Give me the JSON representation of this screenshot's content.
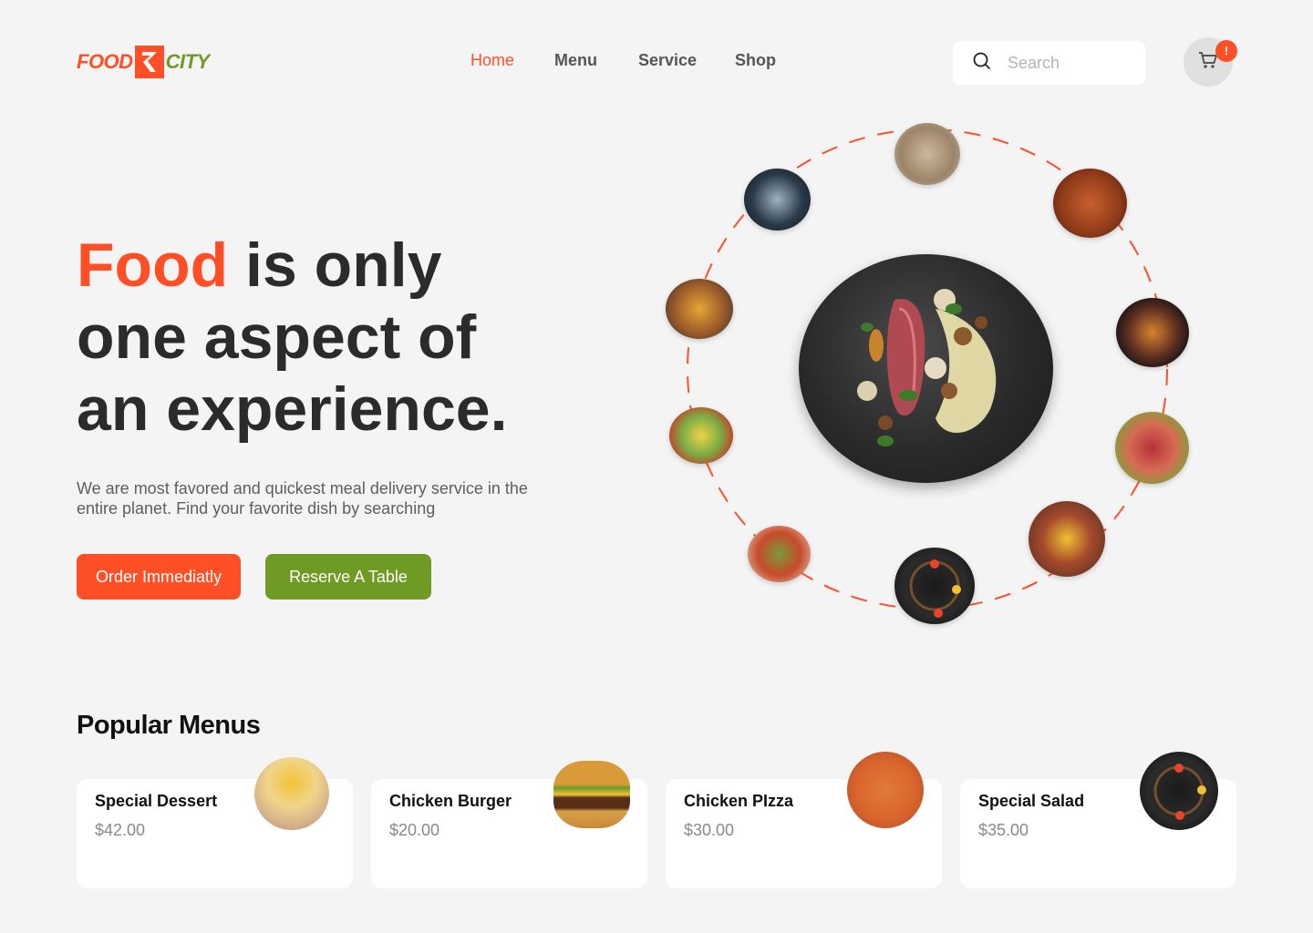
{
  "brand": {
    "word1": "FOOD",
    "word2": "CITY",
    "primary_color": "#ff4f27",
    "secondary_color": "#6f9b24"
  },
  "nav": {
    "items": [
      {
        "label": "Home",
        "active": true
      },
      {
        "label": "Menu",
        "active": false
      },
      {
        "label": "Service",
        "active": false
      },
      {
        "label": "Shop",
        "active": false
      }
    ]
  },
  "search": {
    "placeholder": "Search",
    "icon": "search-icon"
  },
  "cart": {
    "icon": "cart-icon",
    "badge": "!"
  },
  "hero": {
    "title_accent": "Food",
    "title_rest1": " is only",
    "title_line2": "one aspect of",
    "title_line3": "an experience.",
    "subtitle": "We are most favored and quickest meal delivery service in the entire planet. Find your favorite dish by searching",
    "order_button": "Order Immediatly",
    "reserve_button": "Reserve A Table"
  },
  "popular": {
    "title": "Popular Menus",
    "items": [
      {
        "name": "Special Dessert",
        "price": "$42.00"
      },
      {
        "name": "Chicken Burger",
        "price": "$20.00"
      },
      {
        "name": "Chicken PIzza",
        "price": "$30.00"
      },
      {
        "name": "Special Salad",
        "price": "$35.00"
      }
    ]
  }
}
